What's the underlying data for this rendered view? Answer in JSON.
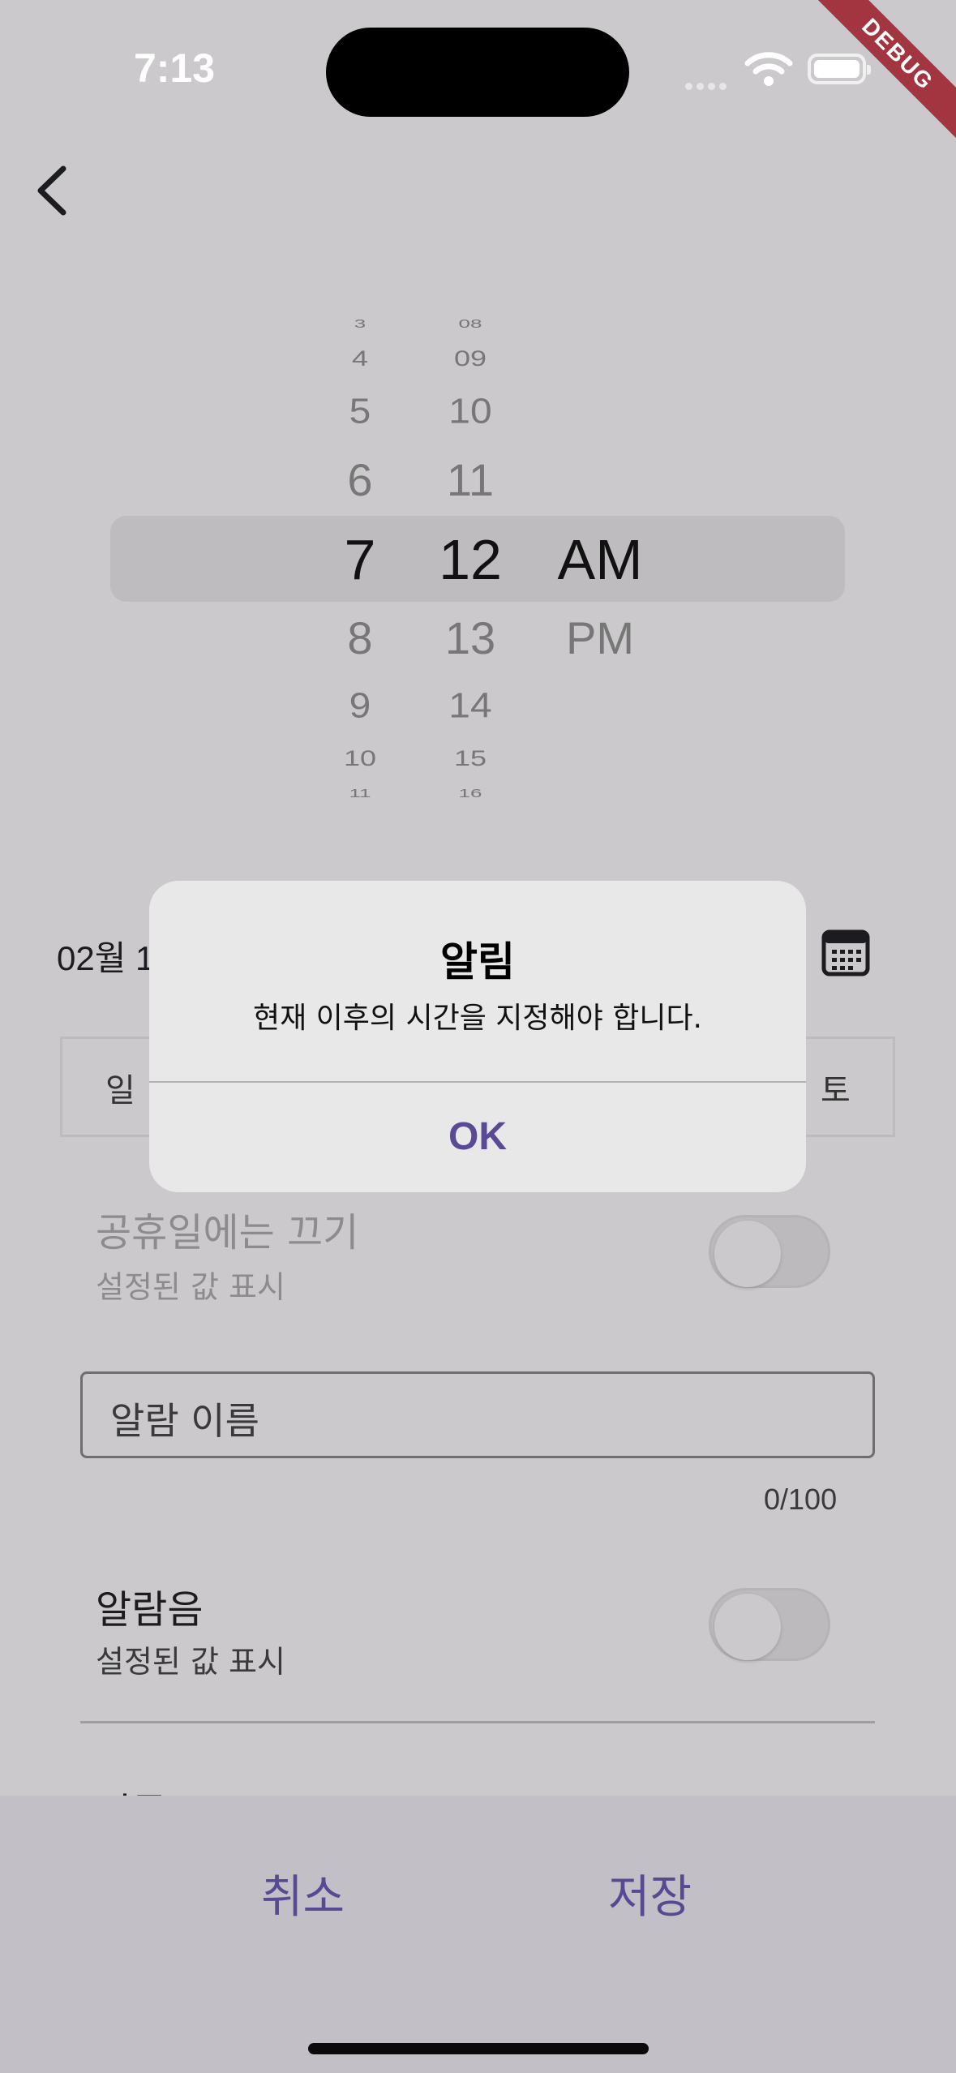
{
  "status_bar": {
    "time": "7:13",
    "debug_banner": "DEBUG"
  },
  "time_picker": {
    "hours": [
      "3",
      "4",
      "5",
      "6",
      "7",
      "8",
      "9",
      "10",
      "11"
    ],
    "minutes": [
      "08",
      "09",
      "10",
      "11",
      "12",
      "13",
      "14",
      "15",
      "16"
    ],
    "periods": [
      "AM",
      "PM"
    ],
    "selected": {
      "hour": "7",
      "minute": "12",
      "period": "AM"
    }
  },
  "date": {
    "label": "02월 1"
  },
  "weekdays": {
    "sunday": "일",
    "saturday": "토"
  },
  "holiday_off": {
    "title": "공휴일에는 끄기",
    "subtitle": "설정된 값 표시",
    "enabled": false
  },
  "alarm_name": {
    "placeholder": "알람 이름",
    "counter": "0/100"
  },
  "alarm_sound": {
    "title": "알람음",
    "subtitle": "설정된 값 표시",
    "enabled": false
  },
  "vibration": {
    "title": "진동"
  },
  "bottom_bar": {
    "cancel_label": "취소",
    "save_label": "저장"
  },
  "dialog": {
    "title": "알림",
    "message": "현재 이후의 시간을 지정해야 합니다.",
    "ok_label": "OK"
  },
  "colors": {
    "accent": "#574a92",
    "debug": "#a2353f"
  }
}
